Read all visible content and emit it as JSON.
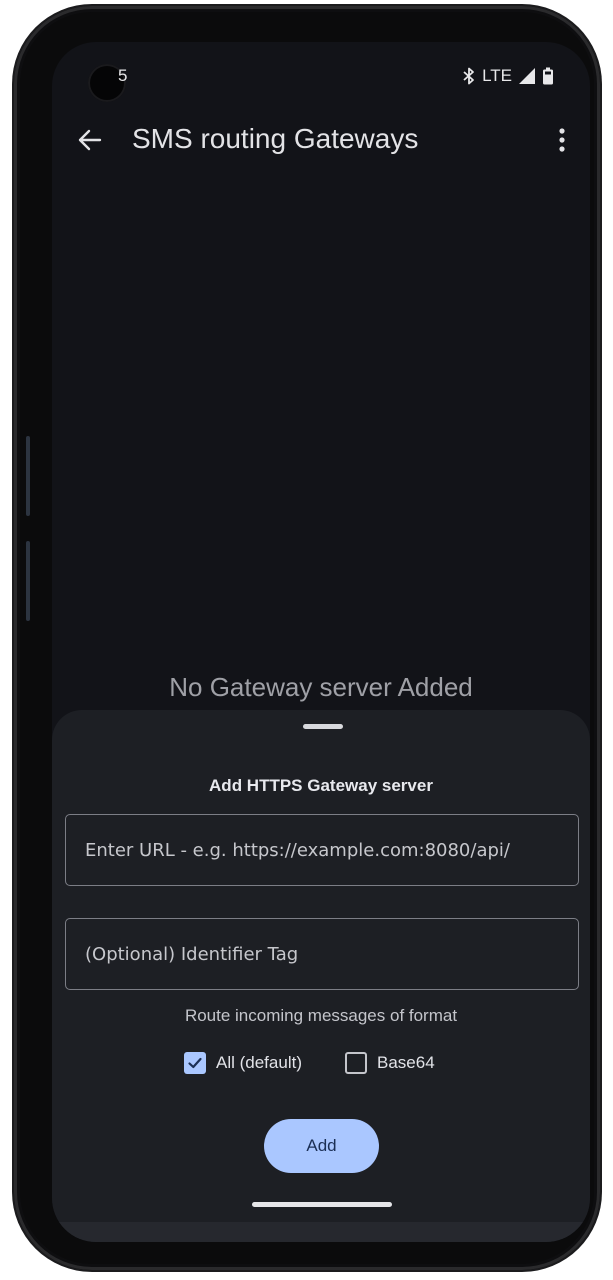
{
  "status_bar": {
    "time": "5",
    "network": "LTE",
    "icons": [
      "bluetooth-icon",
      "signal-icon",
      "battery-icon"
    ]
  },
  "app_bar": {
    "title": "SMS routing Gateways",
    "icons": [
      "back-arrow-icon",
      "more-vert-icon"
    ]
  },
  "empty_state": {
    "text": "No Gateway server Added"
  },
  "sheet": {
    "title": "Add HTTPS Gateway server",
    "url_field": {
      "placeholder": "Enter URL - e.g. https://example.com:8080/api/",
      "value": ""
    },
    "tag_field": {
      "placeholder": "(Optional) Identifier Tag",
      "value": ""
    },
    "route_label": "Route incoming messages of format",
    "formats": [
      {
        "label": "All (default)",
        "checked": true
      },
      {
        "label": "Base64",
        "checked": false
      }
    ],
    "add_label": "Add"
  },
  "colors": {
    "screen_background": "#121318",
    "sheet_background": "#1d1f24",
    "accent": "#aac7ff",
    "text_primary": "#e3e3e6",
    "text_muted": "#9fa0a6"
  }
}
